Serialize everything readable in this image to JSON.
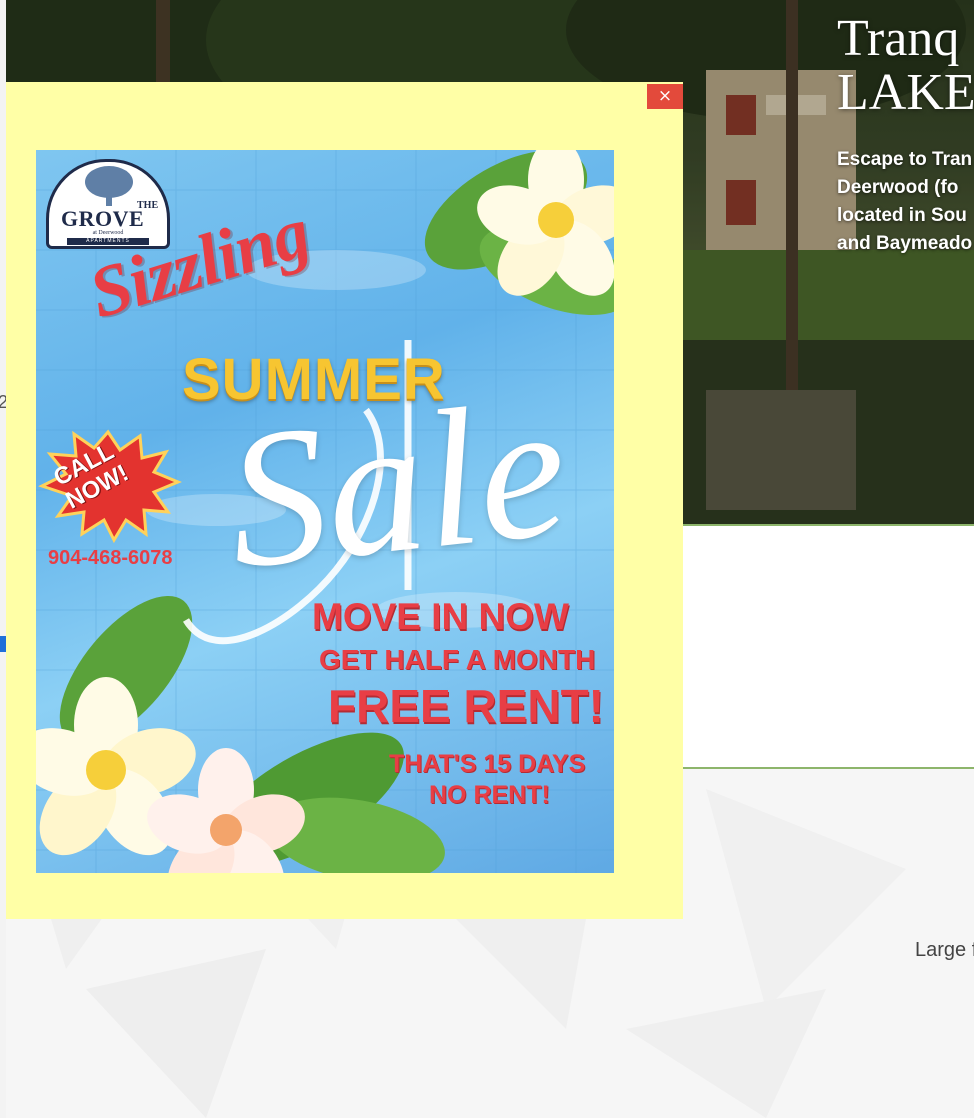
{
  "hero": {
    "title_line1": "Tranq",
    "title_line2": "LAKE",
    "subtitle_lines": [
      "Escape to Tran",
      "Deerwood (fo",
      "located in Sou",
      "and Baymeado"
    ]
  },
  "left_edge": {
    "char": "2"
  },
  "lower": {
    "large_text": "Large f"
  },
  "modal": {
    "close_label": "×",
    "promo": {
      "logo": {
        "the": "THE",
        "name": "GROVE",
        "subname": "at Deerwood",
        "apartments": "APARTMENTS"
      },
      "headline_sizzling": "Sizzling",
      "headline_summer": "SUMMER",
      "headline_sale": "Sale",
      "call_line1": "CALL",
      "call_line2": "NOW!",
      "phone": "904-468-6078",
      "move_in": "MOVE IN NOW",
      "half_month": "GET HALF A MONTH",
      "free_rent": "FREE RENT!",
      "fifteen_days": "THAT'S 15 DAYS",
      "no_rent": "NO RENT!"
    }
  },
  "colors": {
    "modal_bg": "#ffffa6",
    "close_button": "#e34a3b",
    "accent_green": "#8db56b",
    "promo_red": "#e83e45",
    "summer_gold": "#f7c531"
  }
}
